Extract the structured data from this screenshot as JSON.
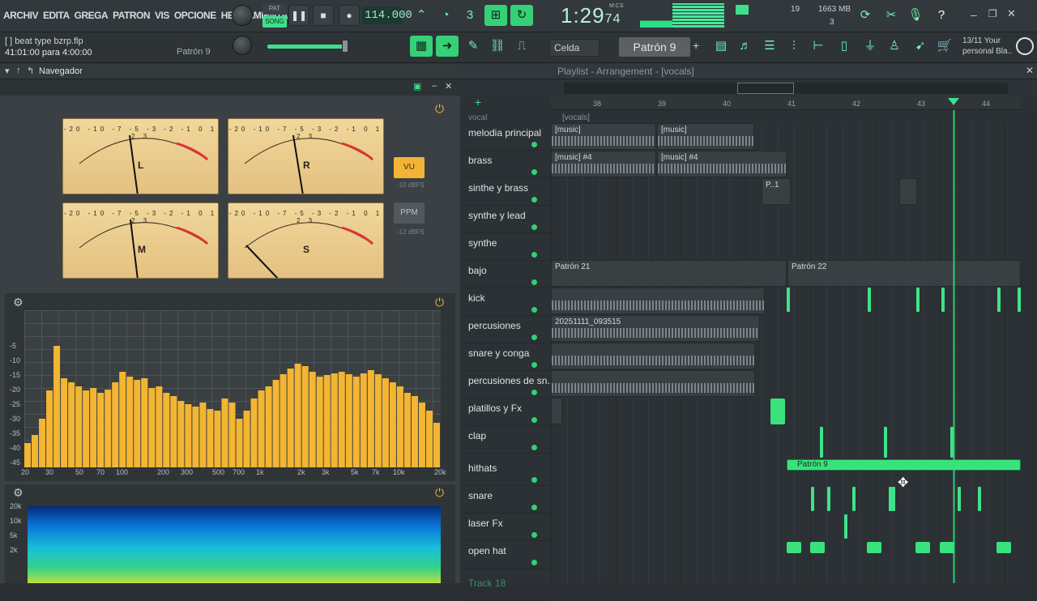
{
  "menu": [
    "ARCHIV",
    "EDITA",
    "GREGA",
    "PATRON",
    "VIS",
    "OPCIONE",
    "HERRAMIENTA"
  ],
  "transport": {
    "pat": "PAT",
    "song": "SONG",
    "tempo": "114.000",
    "time": "1:29",
    "time_ms": "74",
    "mcs": "M:CS"
  },
  "sys": {
    "cpu": "19",
    "mem": "1663 MB",
    "poly": "3"
  },
  "hint": {
    "file": "[ ] beat type bzrp.flp",
    "pos": "41:01:00 para 4:00:00",
    "pattern": "Patrón 9"
  },
  "snap": "Celda",
  "current_pattern": "Patrón 9",
  "news": {
    "date": "13/11",
    "text1": "Your",
    "text2": "personal Bla.."
  },
  "browser": {
    "title": "Navegador"
  },
  "playlist": {
    "title": "Playlist - Arrangement",
    "sub": "[vocals]",
    "vocal_lane": "vocal",
    "vocals_clip": "[vocals]"
  },
  "meters": {
    "L": "L",
    "R": "R",
    "M": "M",
    "S": "S",
    "vu": "VU",
    "ppm": "PPM",
    "vu_dbfs": "-10 dBFS",
    "ppm_dbfs": "-12 dBFS",
    "scale": "-20 -10 -7 -5 -3 -2 -1 0 1 2 3"
  },
  "spectrum": {
    "ylabels": [
      "-5",
      "-10",
      "-15",
      "-20",
      "-25",
      "-30",
      "-35",
      "-40",
      "-45"
    ],
    "xlabels": [
      "20",
      "30",
      "50",
      "70",
      "100",
      "200",
      "300",
      "500",
      "700",
      "1k",
      "2k",
      "3k",
      "5k",
      "7k",
      "10k",
      "20k"
    ],
    "spectro_labels": [
      "20k",
      "10k",
      "5k",
      "2k"
    ]
  },
  "ruler": [
    "38",
    "39",
    "40",
    "41",
    "42",
    "43",
    "44"
  ],
  "tracks": [
    "melodia principal",
    "brass",
    "sinthe y brass",
    "synthe y lead",
    "synthe",
    "bajo",
    "kick",
    "percusiones",
    "snare y conga",
    "percusiones de sn..",
    "platillos y Fx",
    "clap",
    "hithats",
    "snare",
    "laser Fx",
    "open hat",
    "Track 18"
  ],
  "clips": {
    "music": "[music]",
    "music4": "[music] #4",
    "p1": "P..1",
    "patron21": "Patrón 21",
    "patron22": "Patrón 22",
    "rec": "20251111_093515",
    "patron9": "Patrón 9"
  }
}
